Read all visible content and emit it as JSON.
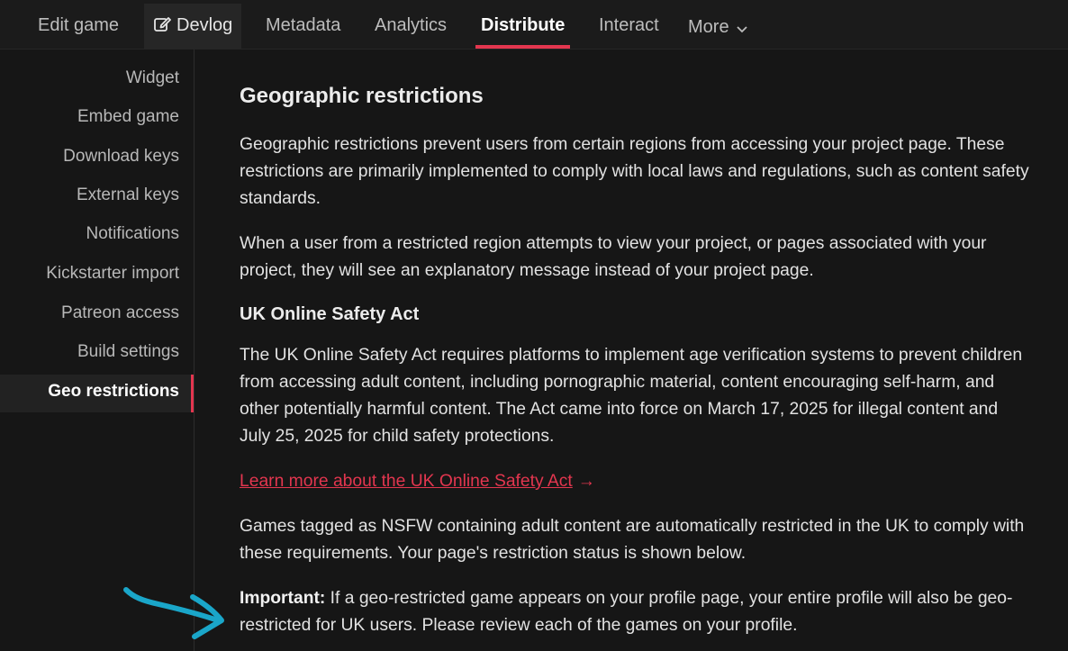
{
  "topnav": {
    "tabs": [
      {
        "label": "Edit game"
      },
      {
        "label": "Devlog",
        "icon": "edit-square-icon"
      },
      {
        "label": "Metadata"
      },
      {
        "label": "Analytics"
      },
      {
        "label": "Distribute",
        "active": true
      },
      {
        "label": "Interact"
      },
      {
        "label": "More",
        "icon": "chevron-down-icon"
      }
    ]
  },
  "sidebar": {
    "items": [
      {
        "label": "Widget"
      },
      {
        "label": "Embed game"
      },
      {
        "label": "Download keys"
      },
      {
        "label": "External keys"
      },
      {
        "label": "Notifications"
      },
      {
        "label": "Kickstarter import"
      },
      {
        "label": "Patreon access"
      },
      {
        "label": "Build settings"
      },
      {
        "label": "Geo restrictions",
        "active": true
      }
    ]
  },
  "main": {
    "title": "Geographic restrictions",
    "para1": "Geographic restrictions prevent users from certain regions from accessing your project page. These restrictions are primarily implemented to comply with local laws and regulations, such as content safety standards.",
    "para2": "When a user from a restricted region attempts to view your project, or pages associated with your project, they will see an explanatory message instead of your project page.",
    "uk_heading": "UK Online Safety Act",
    "para3": "The UK Online Safety Act requires platforms to implement age verification systems to prevent children from accessing adult content, including pornographic material, content encouraging self-harm, and other potentially harmful content. The Act came into force on March 17, 2025 for illegal content and July 25, 2025 for child safety protections.",
    "learn_more_link": "Learn more about the UK Online Safety Act",
    "learn_more_arrow": "→",
    "para4": "Games tagged as NSFW containing adult content are automatically restricted in the UK to comply with these requirements. Your page's restriction status is shown below.",
    "important_label": "Important:",
    "important_text": " If a geo-restricted game appears on your profile page, your entire profile will also be geo-restricted for UK users. Please review each of the games on your profile."
  },
  "colors": {
    "accent": "#e3364f",
    "annotation_arrow": "#1aa6c9",
    "background": "#161616"
  }
}
